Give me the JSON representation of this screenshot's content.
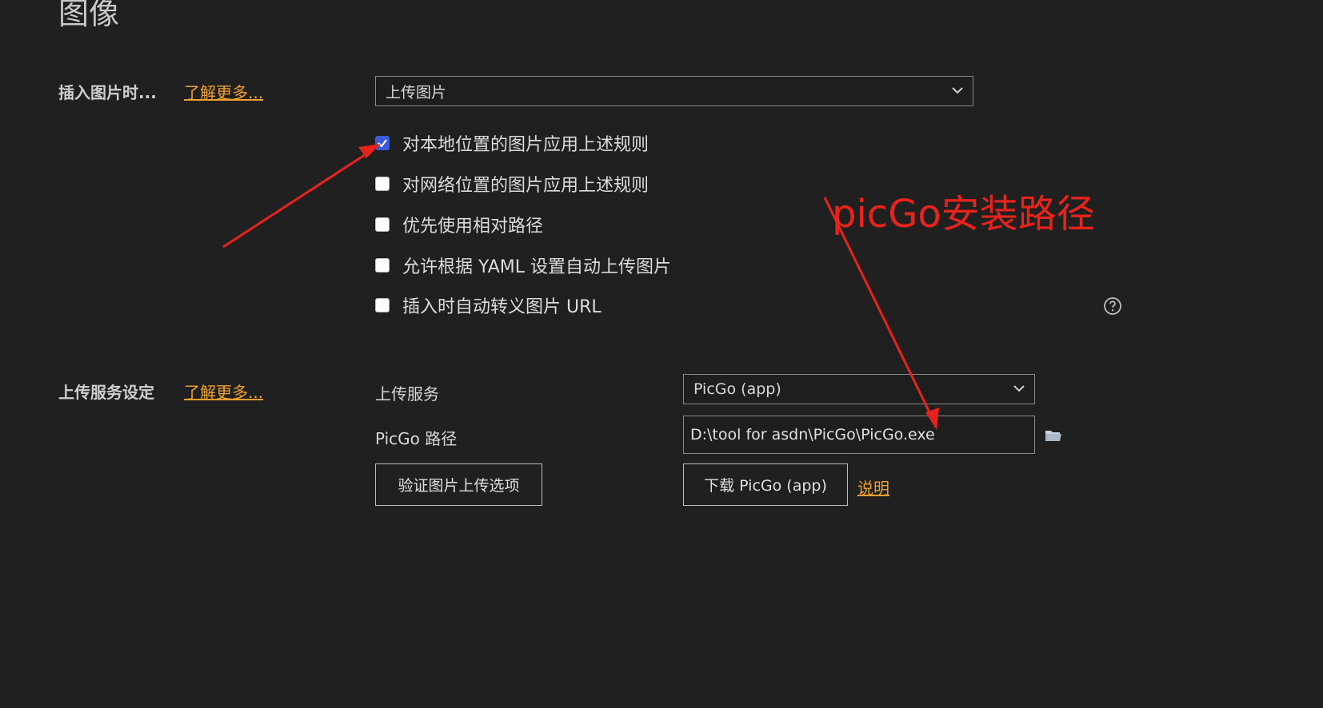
{
  "section": {
    "title": "图像"
  },
  "insert": {
    "label": "插入图片时...",
    "learn_more": "了解更多...",
    "select_value": "上传图片",
    "options": [
      {
        "label": "对本地位置的图片应用上述规则",
        "checked": true
      },
      {
        "label": "对网络位置的图片应用上述规则",
        "checked": false
      },
      {
        "label": "优先使用相对路径",
        "checked": false
      },
      {
        "label": "允许根据 YAML 设置自动上传图片",
        "checked": false
      },
      {
        "label": "插入时自动转义图片 URL",
        "checked": false
      }
    ],
    "help_icon": "question-circle-icon"
  },
  "upload": {
    "label": "上传服务设定",
    "learn_more": "了解更多...",
    "service_label": "上传服务",
    "service_value": "PicGo (app)",
    "path_label": "PicGo 路径",
    "path_value": "D:\\tool for asdn\\PicGo\\PicGo.exe",
    "folder_icon": "folder-icon",
    "verify_button": "验证图片上传选项",
    "download_button": "下载 PicGo (app)",
    "help_link": "说明"
  },
  "annotation": {
    "text": "picGo安装路径",
    "color": "#e8231c"
  },
  "colors": {
    "background": "#202020",
    "link": "#f0a030",
    "checkbox_checked": "#3b5bdb"
  }
}
